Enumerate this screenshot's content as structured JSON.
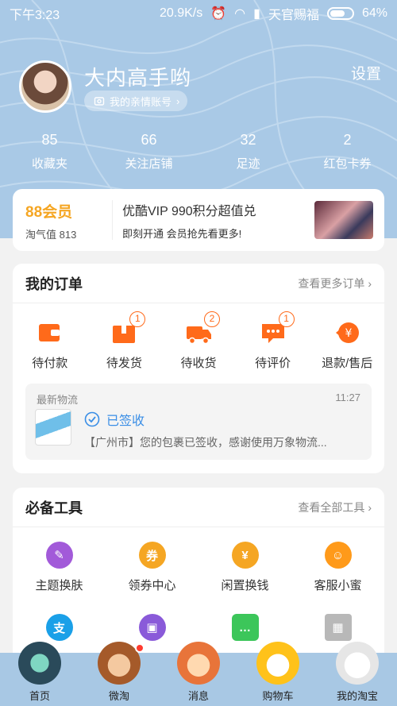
{
  "status_bar": {
    "time": "下午3:23",
    "speed": "20.9K/s",
    "carrier": "天官赐福",
    "battery": "64%"
  },
  "profile": {
    "username": "大内高手哟",
    "family_account": "我的亲情账号",
    "settings": "设置"
  },
  "stats": [
    {
      "value": "85",
      "label": "收藏夹"
    },
    {
      "value": "66",
      "label": "关注店铺"
    },
    {
      "value": "32",
      "label": "足迹"
    },
    {
      "value": "2",
      "label": "红包卡券"
    }
  ],
  "vip": {
    "title": "88会员",
    "value": "淘气值 813",
    "promo": "优酷VIP 990积分超值兑",
    "desc": "即刻开通 会员抢先看更多!"
  },
  "orders": {
    "title": "我的订单",
    "more": "查看更多订单",
    "items": [
      {
        "label": "待付款",
        "badge": ""
      },
      {
        "label": "待发货",
        "badge": "1"
      },
      {
        "label": "待收货",
        "badge": "2"
      },
      {
        "label": "待评价",
        "badge": "1"
      },
      {
        "label": "退款/售后",
        "badge": ""
      }
    ],
    "logistics": {
      "head": "最新物流",
      "time": "11:27",
      "status": "已签收",
      "text": "【广州市】您的包裹已签收，感谢使用万象物流..."
    }
  },
  "tools": {
    "title": "必备工具",
    "more": "查看全部工具",
    "items": [
      {
        "label": "主题换肤",
        "icon": "palette-icon",
        "color": "#a25ad9"
      },
      {
        "label": "领券中心",
        "icon": "coupon-icon",
        "color": "#f5a623"
      },
      {
        "label": "闲置换钱",
        "icon": "yen-coin-icon",
        "color": "#f5a623"
      },
      {
        "label": "客服小蜜",
        "icon": "bee-icon",
        "color": "#ff9a1a"
      }
    ]
  },
  "bottom_nav": {
    "items": [
      {
        "label": "首页"
      },
      {
        "label": "微淘"
      },
      {
        "label": "消息"
      },
      {
        "label": "购物车"
      },
      {
        "label": "我的淘宝"
      }
    ]
  },
  "colors": {
    "accent": "#ff6a1a",
    "vip": "#f5a623",
    "header_bg": "#a9c9e6",
    "link_blue": "#3a8ee6"
  }
}
